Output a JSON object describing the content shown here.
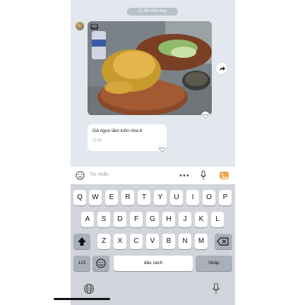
{
  "chat": {
    "time_divider": "21:06 Hôm nay",
    "photo_badge": "HD",
    "message_text": "Gà ngon lắm luôn nha b",
    "message_time": "21:06"
  },
  "input": {
    "placeholder": "Tin nhắn"
  },
  "keyboard": {
    "row1": [
      "Q",
      "W",
      "E",
      "R",
      "T",
      "Y",
      "U",
      "I",
      "O",
      "P"
    ],
    "row2": [
      "A",
      "S",
      "D",
      "F",
      "G",
      "H",
      "J",
      "K",
      "L"
    ],
    "row3": [
      "Z",
      "X",
      "C",
      "V",
      "B",
      "N",
      "M"
    ],
    "numbers_label": "123",
    "space_label": "dấu cách",
    "return_label": "Nhập"
  },
  "colors": {
    "chat_bg": "#e3e8ee",
    "keyboard_bg": "#d1d4db",
    "accent": "#f0a24a"
  },
  "icons": [
    "sticker-icon",
    "more-icon",
    "mic-icon",
    "image-icon",
    "share-icon",
    "heart-icon",
    "shift-icon",
    "backspace-icon",
    "emoji-icon",
    "globe-icon"
  ]
}
